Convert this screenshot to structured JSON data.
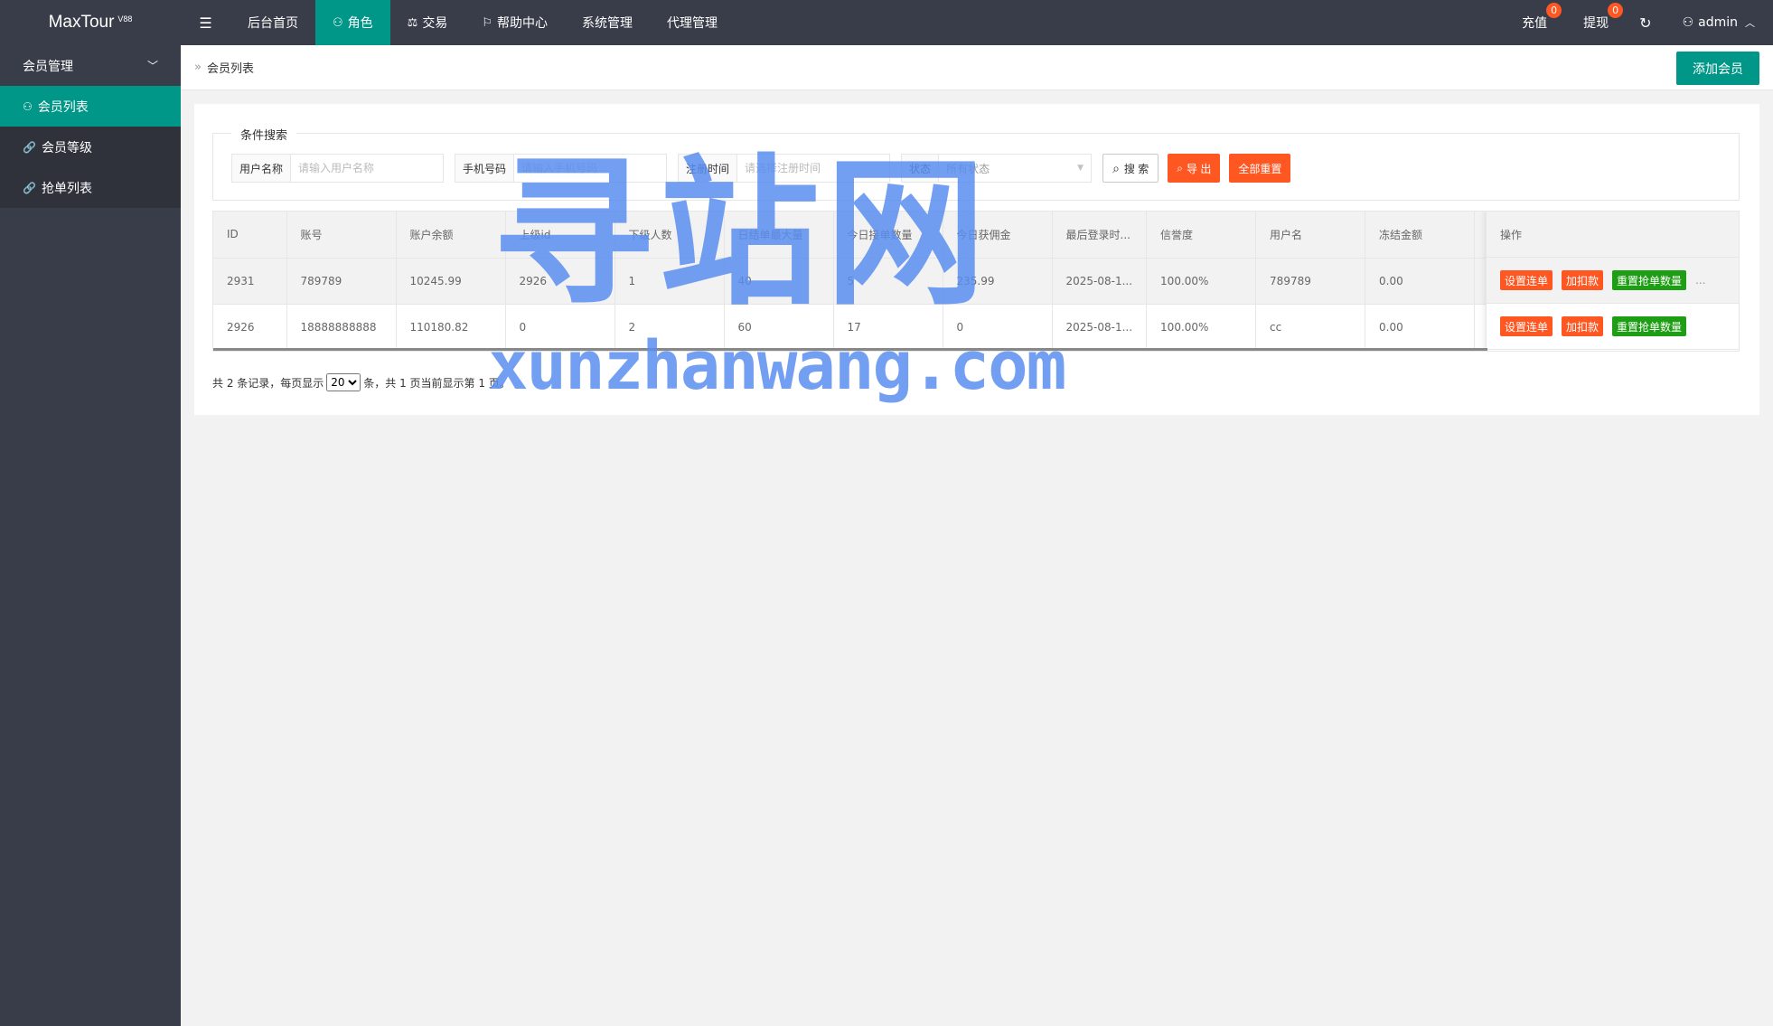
{
  "app": {
    "logo": "MaxTour",
    "logo_sup": "V88"
  },
  "topnav": [
    {
      "label": "后台首页",
      "icon": ""
    },
    {
      "label": "角色",
      "icon": "user-icon",
      "active": true
    },
    {
      "label": "交易",
      "icon": "scale-icon"
    },
    {
      "label": "帮助中心",
      "icon": "flag-icon"
    },
    {
      "label": "系统管理",
      "icon": ""
    },
    {
      "label": "代理管理",
      "icon": ""
    }
  ],
  "right_nav": {
    "recharge": {
      "label": "充值",
      "badge": "0"
    },
    "withdraw": {
      "label": "提现",
      "badge": "0"
    },
    "user": "admin"
  },
  "sidebar": {
    "group": "会员管理",
    "items": [
      {
        "label": "会员列表",
        "active": true
      },
      {
        "label": "会员等级"
      },
      {
        "label": "抢单列表"
      }
    ]
  },
  "breadcrumb": {
    "sep": "»",
    "current": "会员列表"
  },
  "add_button": "添加会员",
  "search": {
    "legend": "条件搜索",
    "username_label": "用户名称",
    "username_placeholder": "请输入用户名称",
    "phone_label": "手机号码",
    "phone_placeholder": "请输入手机号码",
    "regtime_label": "注册时间",
    "regtime_placeholder": "请选择注册时间",
    "status_label": "状态",
    "status_value": "所有状态",
    "search_btn": "搜 索",
    "export_btn": "导 出",
    "reset_btn": "全部重置"
  },
  "table": {
    "columns": [
      "ID",
      "账号",
      "账户余额",
      "上级id",
      "下级人数",
      "日结单最大量",
      "今日接单数量",
      "今日获佣金",
      "最后登录时...",
      "信誉度",
      "用户名",
      "冻结金额",
      "操作"
    ],
    "rows": [
      [
        "2931",
        "789789",
        "10245.99",
        "2926",
        "1",
        "40",
        "5",
        "235.99",
        "2025-08-1...",
        "100.00%",
        "789789",
        "0.00"
      ],
      [
        "2926",
        "18888888888",
        "110180.82",
        "0",
        "2",
        "60",
        "17",
        "0",
        "2025-08-1...",
        "100.00%",
        "cc",
        "0.00"
      ]
    ],
    "ops": {
      "set_chain": "设置连单",
      "add_deduct": "加扣款",
      "reset_grab": "重置抢单数量",
      "more": "..."
    }
  },
  "pager": {
    "prefix": "共 2 条记录，每页显示",
    "page_size": "20",
    "suffix": "条，共 1 页当前显示第 1 页。"
  },
  "watermark": {
    "cn": "寻站网",
    "en": "xunzhanwang.com"
  },
  "colors": {
    "header": "#393d49",
    "accent": "#009688",
    "orange": "#ff5722",
    "green": "#1e9e14"
  }
}
